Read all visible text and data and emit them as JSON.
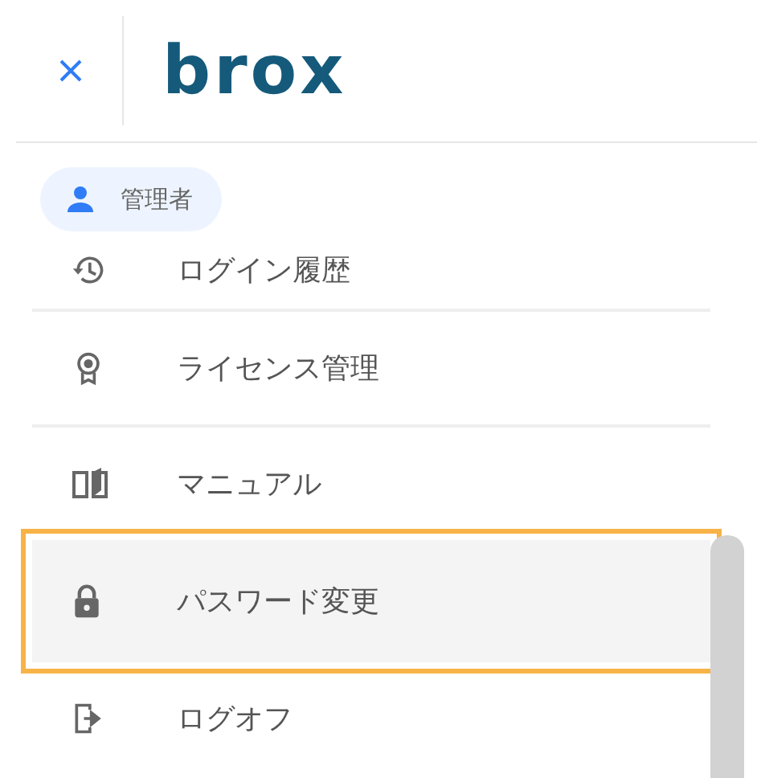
{
  "header": {
    "logo": "brox"
  },
  "user_chip": {
    "label": "管理者"
  },
  "menu": [
    {
      "label": "ログイン履歴",
      "selected": false
    },
    {
      "label": "ライセンス管理",
      "selected": false
    },
    {
      "label": "マニュアル",
      "selected": false
    },
    {
      "label": "パスワード変更",
      "selected": true
    },
    {
      "label": "ログオフ",
      "selected": false
    }
  ]
}
